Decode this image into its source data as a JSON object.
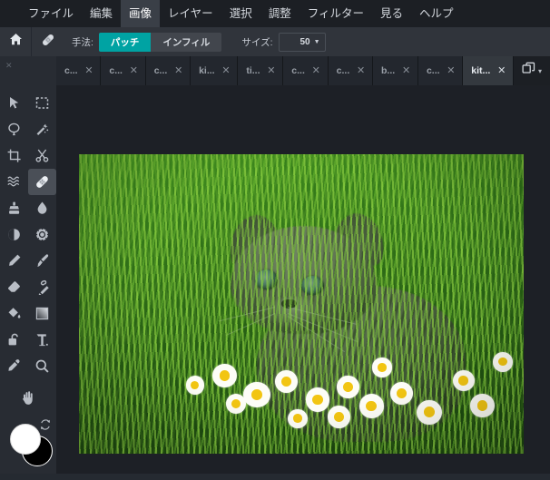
{
  "menubar": {
    "items": [
      {
        "label": "ファイル",
        "highlight": false
      },
      {
        "label": "編集",
        "highlight": false
      },
      {
        "label": "画像",
        "highlight": true
      },
      {
        "label": "レイヤー",
        "highlight": false
      },
      {
        "label": "選択",
        "highlight": false
      },
      {
        "label": "調整",
        "highlight": false
      },
      {
        "label": "フィルター",
        "highlight": false
      },
      {
        "label": "見る",
        "highlight": false
      },
      {
        "label": "ヘルプ",
        "highlight": false
      }
    ]
  },
  "options_bar": {
    "home_icon": "home-icon",
    "tool_icon": "bandage-icon",
    "method_label": "手法:",
    "method_options": [
      {
        "label": "パッチ",
        "active": true
      },
      {
        "label": "インフィル",
        "active": false
      }
    ],
    "size_label": "サイズ:",
    "size_value": "50",
    "accent_color": "#00a3a3"
  },
  "tabs": {
    "items": [
      {
        "label": "c...",
        "active": false
      },
      {
        "label": "c...",
        "active": false
      },
      {
        "label": "c...",
        "active": false
      },
      {
        "label": "ki...",
        "active": false
      },
      {
        "label": "ti...",
        "active": false
      },
      {
        "label": "c...",
        "active": false
      },
      {
        "label": "c...",
        "active": false
      },
      {
        "label": "b...",
        "active": false
      },
      {
        "label": "c...",
        "active": false
      },
      {
        "label": "kit...",
        "active": true
      }
    ],
    "close_glyph": "✕",
    "window_icon": "windows-stack-icon",
    "window_caret": "▾"
  },
  "toolbar": {
    "tools": [
      {
        "name": "move-tool",
        "icon": "arrow-cursor-icon",
        "active": false
      },
      {
        "name": "marquee-select-tool",
        "icon": "dashed-rectangle-icon",
        "active": false
      },
      {
        "name": "lasso-tool",
        "icon": "lasso-icon",
        "active": false
      },
      {
        "name": "magic-wand-tool",
        "icon": "magic-wand-icon",
        "active": false
      },
      {
        "name": "crop-tool",
        "icon": "crop-icon",
        "active": false
      },
      {
        "name": "cut-tool",
        "icon": "scissors-icon",
        "active": false
      },
      {
        "name": "liquify-tool",
        "icon": "waves-icon",
        "active": false
      },
      {
        "name": "heal-tool",
        "icon": "bandage-icon",
        "active": true
      },
      {
        "name": "clone-stamp-tool",
        "icon": "stamp-icon",
        "active": false
      },
      {
        "name": "blur-tool",
        "icon": "water-drop-icon",
        "active": false
      },
      {
        "name": "dodge-burn-tool",
        "icon": "half-circle-icon",
        "active": false
      },
      {
        "name": "sharpen-tool",
        "icon": "sun-gear-icon",
        "active": false
      },
      {
        "name": "pencil-tool",
        "icon": "pencil-icon",
        "active": false
      },
      {
        "name": "paintbrush-tool",
        "icon": "paintbrush-icon",
        "active": false
      },
      {
        "name": "eraser-tool",
        "icon": "eraser-icon",
        "active": false
      },
      {
        "name": "smudge-tool",
        "icon": "smudge-brush-icon",
        "active": false
      },
      {
        "name": "paint-bucket-tool",
        "icon": "paint-bucket-icon",
        "active": false
      },
      {
        "name": "gradient-tool",
        "icon": "gradient-square-icon",
        "active": false
      },
      {
        "name": "shape-tool",
        "icon": "lock-shape-icon",
        "active": false
      },
      {
        "name": "text-tool",
        "icon": "text-t-icon",
        "active": false
      },
      {
        "name": "color-picker-tool",
        "icon": "eyedropper-icon",
        "active": false
      },
      {
        "name": "zoom-tool",
        "icon": "magnifier-icon",
        "active": false
      }
    ],
    "pan_tool": {
      "name": "pan-tool",
      "icon": "hand-icon"
    },
    "foreground_color": "#ffffff",
    "background_color": "#000000",
    "swap_icon": "swap-arrows-icon"
  },
  "canvas": {
    "document_name": "kit...",
    "image_description": "grey tabby kitten sitting in green grass with white daisies"
  },
  "theme": {
    "menubar_bg": "#1c1f24",
    "optionsbar_bg": "#30343b",
    "toolbar_bg": "#282c33",
    "canvas_bg": "#1d2026",
    "tab_active_bg": "#34393f"
  }
}
